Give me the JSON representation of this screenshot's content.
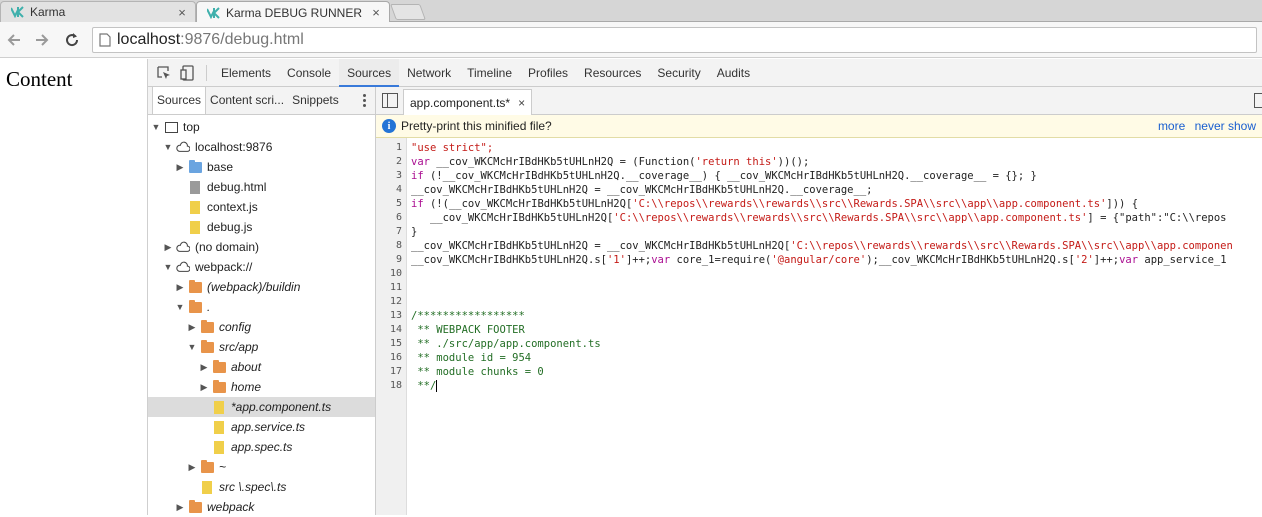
{
  "browser": {
    "tabs": [
      {
        "title": "Karma",
        "close": "×"
      },
      {
        "title": "Karma DEBUG RUNNER",
        "close": "×"
      }
    ],
    "url_host": "localhost",
    "url_rest": ":9876/debug.html"
  },
  "page": {
    "content": "Content"
  },
  "devtools": {
    "tabs": [
      "Elements",
      "Console",
      "Sources",
      "Network",
      "Timeline",
      "Profiles",
      "Resources",
      "Security",
      "Audits"
    ],
    "selected_tab": "Sources",
    "navigator_tabs": [
      "Sources",
      "Content scri...",
      "Snippets"
    ],
    "tree": [
      {
        "label": "top",
        "icon": "frame"
      },
      {
        "label": "localhost:9876",
        "icon": "cloud"
      },
      {
        "label": "base",
        "icon": "folder-blue"
      },
      {
        "label": "debug.html",
        "icon": "file-gray"
      },
      {
        "label": "context.js",
        "icon": "file-yellow"
      },
      {
        "label": "debug.js",
        "icon": "file-yellow"
      },
      {
        "label": "(no domain)",
        "icon": "cloud"
      },
      {
        "label": "webpack://",
        "icon": "cloud"
      },
      {
        "label": "(webpack)/buildin",
        "icon": "folder-orange"
      },
      {
        "label": ".",
        "icon": "folder-orange"
      },
      {
        "label": "config",
        "icon": "folder-orange"
      },
      {
        "label": "src/app",
        "icon": "folder-orange"
      },
      {
        "label": "about",
        "icon": "folder-orange"
      },
      {
        "label": "home",
        "icon": "folder-orange"
      },
      {
        "label": "*app.component.ts",
        "icon": "file-yellow"
      },
      {
        "label": "app.service.ts",
        "icon": "file-yellow"
      },
      {
        "label": "app.spec.ts",
        "icon": "file-yellow"
      },
      {
        "label": "~",
        "icon": "folder-orange"
      },
      {
        "label": "src \\.spec\\.ts",
        "icon": "file-yellow"
      },
      {
        "label": "webpack",
        "icon": "folder-orange"
      }
    ],
    "editor": {
      "file_tab": "app.component.ts*",
      "file_tab_close": "×",
      "infobar_text": "Pretty-print this minified file?",
      "infobar_more": "more",
      "infobar_never": "never show",
      "line_numbers": [
        "1",
        "2",
        "3",
        "4",
        "5",
        "6",
        "7",
        "8",
        "9",
        "10",
        "11",
        "12",
        "13",
        "14",
        "15",
        "16",
        "17",
        "18"
      ],
      "code": {
        "l1": "\"use strict\";",
        "l2a": "var",
        "l2b": " __cov_WKCMcHrIBdHKb5tUHLnH2Q = (Function(",
        "l2c": "'return this'",
        "l2d": "))();",
        "l3a": "if",
        "l3b": " (!__cov_WKCMcHrIBdHKb5tUHLnH2Q.__coverage__) { __cov_WKCMcHrIBdHKb5tUHLnH2Q.__coverage__ = {}; }",
        "l4": "__cov_WKCMcHrIBdHKb5tUHLnH2Q = __cov_WKCMcHrIBdHKb5tUHLnH2Q.__coverage__;",
        "l5a": "if",
        "l5b": " (!(__cov_WKCMcHrIBdHKb5tUHLnH2Q[",
        "l5c": "'C:\\\\repos\\\\rewards\\\\rewards\\\\src\\\\Rewards.SPA\\\\src\\\\app\\\\app.component.ts'",
        "l5d": "])) {",
        "l6a": "   __cov_WKCMcHrIBdHKb5tUHLnH2Q[",
        "l6b": "'C:\\\\repos\\\\rewards\\\\rewards\\\\src\\\\Rewards.SPA\\\\src\\\\app\\\\app.component.ts'",
        "l6c": "] = {\"path\":\"C:\\\\repos",
        "l7": "}",
        "l8a": "__cov_WKCMcHrIBdHKb5tUHLnH2Q = __cov_WKCMcHrIBdHKb5tUHLnH2Q[",
        "l8b": "'C:\\\\repos\\\\rewards\\\\rewards\\\\src\\\\Rewards.SPA\\\\src\\\\app\\\\app.componen",
        "l9a": "__cov_WKCMcHrIBdHKb5tUHLnH2Q.s[",
        "l9b": "'1'",
        "l9c": "]++;",
        "l9d": "var",
        "l9e": " core_1=require(",
        "l9f": "'@angular/core'",
        "l9g": ");__cov_WKCMcHrIBdHKb5tUHLnH2Q.s[",
        "l9h": "'2'",
        "l9i": "]++;",
        "l9j": "var",
        "l9k": " app_service_1",
        "l13": "/*****************",
        "l14": " ** WEBPACK FOOTER",
        "l15": " ** ./src/app/app.component.ts",
        "l16": " ** module id = 954",
        "l17": " ** module chunks = 0",
        "l18": " **/"
      }
    }
  }
}
